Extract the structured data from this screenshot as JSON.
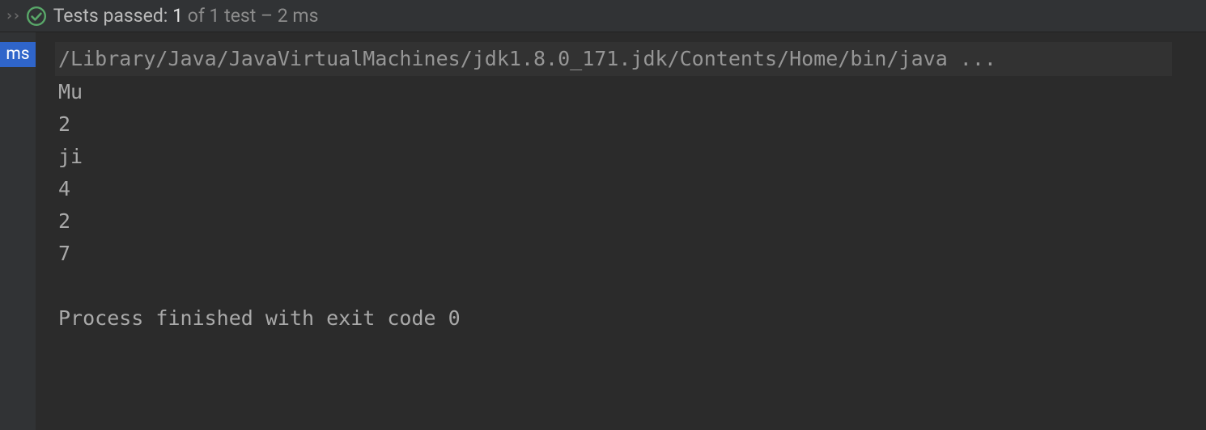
{
  "status": {
    "lead": "Tests passed:",
    "count": "1",
    "rest": " of 1 test – 2 ms"
  },
  "gutter": {
    "ms_label": "ms"
  },
  "console": {
    "command": "/Library/Java/JavaVirtualMachines/jdk1.8.0_171.jdk/Contents/Home/bin/java ...",
    "output": [
      "Mu",
      "2",
      "ji",
      "4",
      "2",
      "7"
    ],
    "exit_message": "Process finished with exit code 0"
  }
}
